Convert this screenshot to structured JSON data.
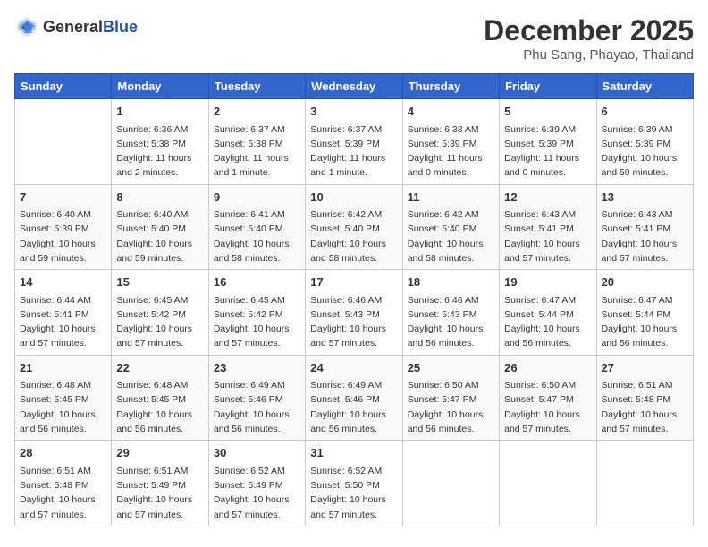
{
  "logo": {
    "text_general": "General",
    "text_blue": "Blue"
  },
  "title": "December 2025",
  "subtitle": "Phu Sang, Phayao, Thailand",
  "headers": [
    "Sunday",
    "Monday",
    "Tuesday",
    "Wednesday",
    "Thursday",
    "Friday",
    "Saturday"
  ],
  "weeks": [
    [
      {
        "day": "",
        "info": ""
      },
      {
        "day": "1",
        "info": "Sunrise: 6:36 AM\nSunset: 5:38 PM\nDaylight: 11 hours\nand 2 minutes."
      },
      {
        "day": "2",
        "info": "Sunrise: 6:37 AM\nSunset: 5:38 PM\nDaylight: 11 hours\nand 1 minute."
      },
      {
        "day": "3",
        "info": "Sunrise: 6:37 AM\nSunset: 5:39 PM\nDaylight: 11 hours\nand 1 minute."
      },
      {
        "day": "4",
        "info": "Sunrise: 6:38 AM\nSunset: 5:39 PM\nDaylight: 11 hours\nand 0 minutes."
      },
      {
        "day": "5",
        "info": "Sunrise: 6:39 AM\nSunset: 5:39 PM\nDaylight: 11 hours\nand 0 minutes."
      },
      {
        "day": "6",
        "info": "Sunrise: 6:39 AM\nSunset: 5:39 PM\nDaylight: 10 hours\nand 59 minutes."
      }
    ],
    [
      {
        "day": "7",
        "info": "Sunrise: 6:40 AM\nSunset: 5:39 PM\nDaylight: 10 hours\nand 59 minutes."
      },
      {
        "day": "8",
        "info": "Sunrise: 6:40 AM\nSunset: 5:40 PM\nDaylight: 10 hours\nand 59 minutes."
      },
      {
        "day": "9",
        "info": "Sunrise: 6:41 AM\nSunset: 5:40 PM\nDaylight: 10 hours\nand 58 minutes."
      },
      {
        "day": "10",
        "info": "Sunrise: 6:42 AM\nSunset: 5:40 PM\nDaylight: 10 hours\nand 58 minutes."
      },
      {
        "day": "11",
        "info": "Sunrise: 6:42 AM\nSunset: 5:40 PM\nDaylight: 10 hours\nand 58 minutes."
      },
      {
        "day": "12",
        "info": "Sunrise: 6:43 AM\nSunset: 5:41 PM\nDaylight: 10 hours\nand 57 minutes."
      },
      {
        "day": "13",
        "info": "Sunrise: 6:43 AM\nSunset: 5:41 PM\nDaylight: 10 hours\nand 57 minutes."
      }
    ],
    [
      {
        "day": "14",
        "info": "Sunrise: 6:44 AM\nSunset: 5:41 PM\nDaylight: 10 hours\nand 57 minutes."
      },
      {
        "day": "15",
        "info": "Sunrise: 6:45 AM\nSunset: 5:42 PM\nDaylight: 10 hours\nand 57 minutes."
      },
      {
        "day": "16",
        "info": "Sunrise: 6:45 AM\nSunset: 5:42 PM\nDaylight: 10 hours\nand 57 minutes."
      },
      {
        "day": "17",
        "info": "Sunrise: 6:46 AM\nSunset: 5:43 PM\nDaylight: 10 hours\nand 57 minutes."
      },
      {
        "day": "18",
        "info": "Sunrise: 6:46 AM\nSunset: 5:43 PM\nDaylight: 10 hours\nand 56 minutes."
      },
      {
        "day": "19",
        "info": "Sunrise: 6:47 AM\nSunset: 5:44 PM\nDaylight: 10 hours\nand 56 minutes."
      },
      {
        "day": "20",
        "info": "Sunrise: 6:47 AM\nSunset: 5:44 PM\nDaylight: 10 hours\nand 56 minutes."
      }
    ],
    [
      {
        "day": "21",
        "info": "Sunrise: 6:48 AM\nSunset: 5:45 PM\nDaylight: 10 hours\nand 56 minutes."
      },
      {
        "day": "22",
        "info": "Sunrise: 6:48 AM\nSunset: 5:45 PM\nDaylight: 10 hours\nand 56 minutes."
      },
      {
        "day": "23",
        "info": "Sunrise: 6:49 AM\nSunset: 5:46 PM\nDaylight: 10 hours\nand 56 minutes."
      },
      {
        "day": "24",
        "info": "Sunrise: 6:49 AM\nSunset: 5:46 PM\nDaylight: 10 hours\nand 56 minutes."
      },
      {
        "day": "25",
        "info": "Sunrise: 6:50 AM\nSunset: 5:47 PM\nDaylight: 10 hours\nand 56 minutes."
      },
      {
        "day": "26",
        "info": "Sunrise: 6:50 AM\nSunset: 5:47 PM\nDaylight: 10 hours\nand 57 minutes."
      },
      {
        "day": "27",
        "info": "Sunrise: 6:51 AM\nSunset: 5:48 PM\nDaylight: 10 hours\nand 57 minutes."
      }
    ],
    [
      {
        "day": "28",
        "info": "Sunrise: 6:51 AM\nSunset: 5:48 PM\nDaylight: 10 hours\nand 57 minutes."
      },
      {
        "day": "29",
        "info": "Sunrise: 6:51 AM\nSunset: 5:49 PM\nDaylight: 10 hours\nand 57 minutes."
      },
      {
        "day": "30",
        "info": "Sunrise: 6:52 AM\nSunset: 5:49 PM\nDaylight: 10 hours\nand 57 minutes."
      },
      {
        "day": "31",
        "info": "Sunrise: 6:52 AM\nSunset: 5:50 PM\nDaylight: 10 hours\nand 57 minutes."
      },
      {
        "day": "",
        "info": ""
      },
      {
        "day": "",
        "info": ""
      },
      {
        "day": "",
        "info": ""
      }
    ]
  ]
}
